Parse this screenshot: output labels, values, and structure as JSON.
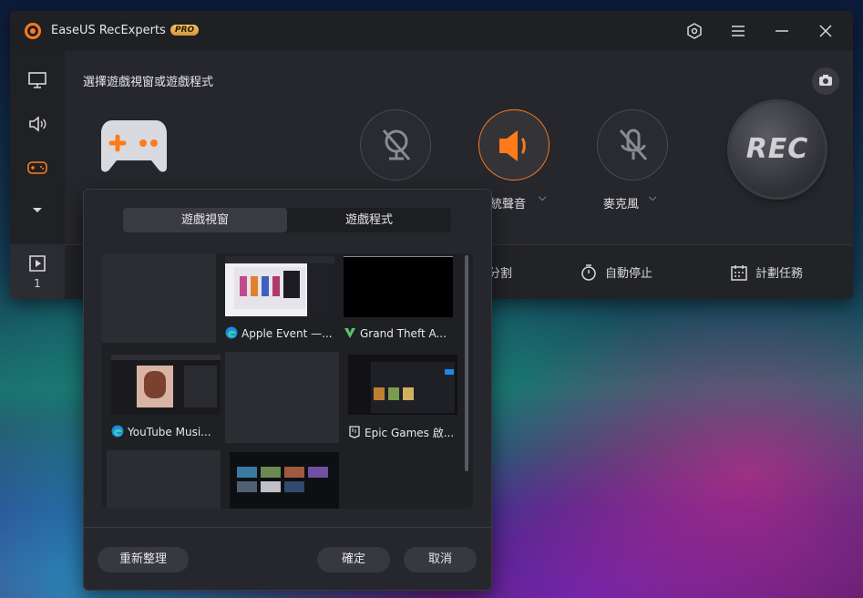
{
  "app": {
    "title": "EaseUS RecExperts",
    "badge": "PRO"
  },
  "window_buttons": [
    "settings-icon",
    "menu-icon",
    "minimize-icon",
    "close-icon"
  ],
  "sidebar": {
    "items": [
      "monitor-icon",
      "speaker-icon",
      "gamepad-icon",
      "chevron-down-icon"
    ],
    "recordings_count": "1"
  },
  "main": {
    "section_title": "選擇遊戲視窗或遊戲程式",
    "webcam_label": "",
    "system_sound_label": "統聲音",
    "microphone_label": "麥克風",
    "rec_label": "REC"
  },
  "bottom_bar": {
    "split_label": "分割",
    "auto_stop_label": "自動停止",
    "schedule_label": "計劃任務"
  },
  "popup": {
    "tab_game_window": "遊戲視窗",
    "tab_game_program": "遊戲程式",
    "windows": [
      {
        "label": "",
        "empty": true
      },
      {
        "label": "Apple Event —...",
        "icon": "edge-icon"
      },
      {
        "label": "Grand Theft A...",
        "icon": "gta-icon"
      },
      {
        "label": "YouTube Musi...",
        "icon": "edge-icon"
      },
      {
        "label": "",
        "empty": true
      },
      {
        "label": "Epic Games 啟...",
        "icon": "epic-icon"
      },
      {
        "label": "",
        "empty": true
      },
      {
        "label": "",
        "icon": ""
      }
    ],
    "refresh_label": "重新整理",
    "confirm_label": "確定",
    "cancel_label": "取消"
  },
  "colors": {
    "accent": "#ff7a1a",
    "panel": "#26272c"
  }
}
